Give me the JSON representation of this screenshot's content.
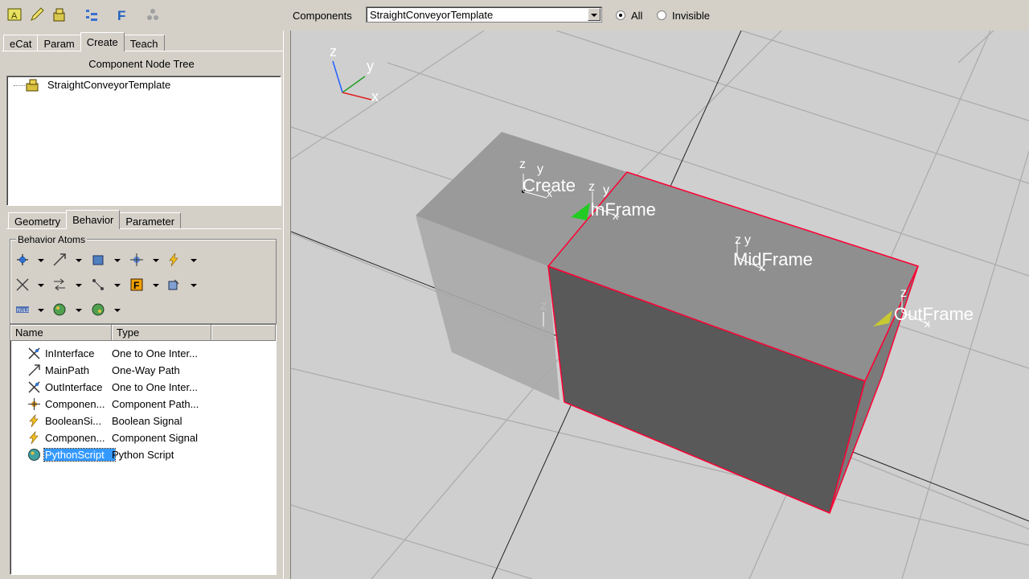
{
  "toolbar": {
    "icons": [
      "component-icon",
      "pencil-icon",
      "robot-icon",
      "tree-icon",
      "function-f-icon",
      "molecule-icon"
    ]
  },
  "main_tabs": [
    "eCat",
    "Param",
    "Create",
    "Teach"
  ],
  "active_main_tab": "Create",
  "node_tree": {
    "title": "Component Node Tree",
    "root": "StraightConveyorTemplate"
  },
  "sub_tabs": [
    "Geometry",
    "Behavior",
    "Parameter"
  ],
  "active_sub_tab": "Behavior",
  "behavior_atoms": {
    "label": "Behavior Atoms"
  },
  "behavior_list": {
    "columns": [
      "Name",
      "Type"
    ],
    "rows": [
      {
        "name": "InInterface",
        "type": "One to One Inter...",
        "icon": "interface-icon"
      },
      {
        "name": "MainPath",
        "type": "One-Way Path",
        "icon": "path-icon"
      },
      {
        "name": "OutInterface",
        "type": "One to One Inter...",
        "icon": "interface-icon"
      },
      {
        "name": "Componen...",
        "type": "Component Path...",
        "icon": "component-path-icon"
      },
      {
        "name": "BooleanSi...",
        "type": "Boolean Signal",
        "icon": "signal-bolt-icon"
      },
      {
        "name": "Componen...",
        "type": "Component Signal",
        "icon": "signal-bolt-icon"
      },
      {
        "name": "PythonScript",
        "type": "Python Script",
        "icon": "python-icon",
        "selected": true
      }
    ]
  },
  "viewport_header": {
    "components_label": "Components",
    "selected_component": "StraightConveyorTemplate",
    "radio_all": "All",
    "radio_invisible": "Invisible",
    "selected_radio": "All"
  },
  "viewport": {
    "axis_labels": {
      "z": "z",
      "y": "y",
      "x": "x"
    },
    "frame_labels": {
      "create": "Create",
      "inframe": "InFrame",
      "midframe": "MidFrame",
      "outframe": "OutFrame"
    },
    "colors": {
      "floor": "#cfcfcf",
      "box_top": "#8a8a8a",
      "box_front": "#5a5a5a",
      "selection_edge": "#ff0033",
      "frame_marker_green": "#22cc22",
      "frame_marker_yellow": "#c8c832"
    }
  }
}
